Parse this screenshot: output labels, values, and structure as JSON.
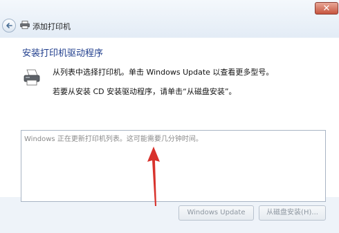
{
  "window": {
    "title": "添加打印机",
    "close_glyph": "✕"
  },
  "main": {
    "heading": "安装打印机驱动程序",
    "instruction_1": "从列表中选择打印机。单击 Windows Update 以查看更多型号。",
    "instruction_2": "若要从安装 CD 安装驱动程序，请单击“从磁盘安装”。",
    "list_message": "Windows 正在更新打印机列表。这可能需要几分钟时间。"
  },
  "buttons": {
    "windows_update": "Windows Update",
    "install_from_disk": "从磁盘安装(H)..."
  },
  "icons": {
    "back": "back-arrow-icon",
    "printer": "printer-icon",
    "annotation": "red-arrow"
  },
  "colors": {
    "heading": "#1f3d8c",
    "annotation_arrow": "#d8322c",
    "window_bg": "#eef3f9",
    "content_bg": "#ffffff"
  }
}
